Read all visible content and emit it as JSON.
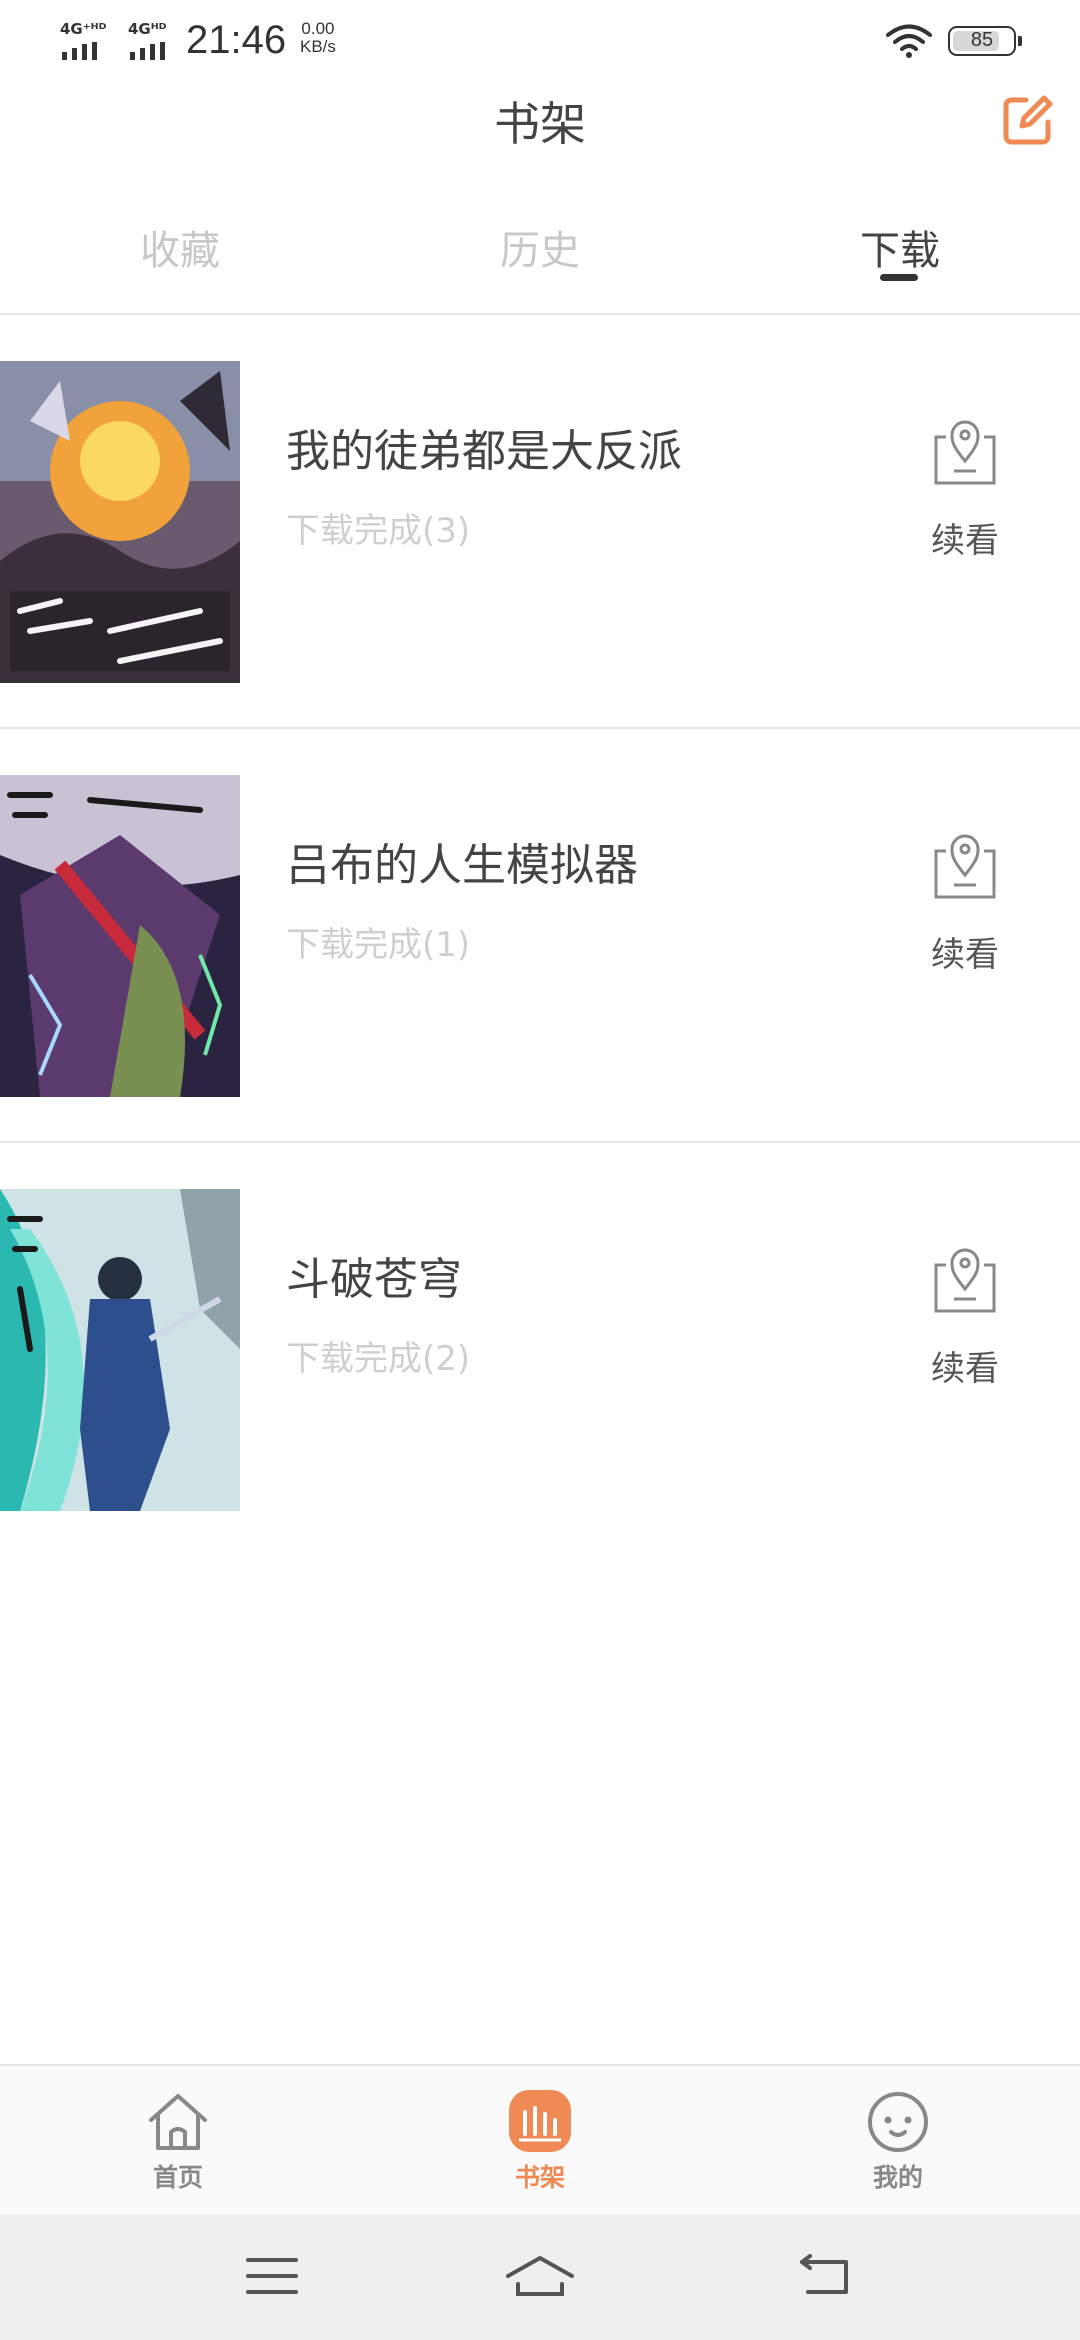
{
  "status_bar": {
    "sim1": "4G⁺ᴴᴰ",
    "sim2": "4Gᴴᴰ",
    "time": "21:46",
    "net_speed_value": "0.00",
    "net_speed_unit": "KB/s",
    "battery": "85"
  },
  "header": {
    "title": "书架",
    "edit_icon": "edit-icon"
  },
  "tabs": [
    {
      "label": "收藏",
      "active": false
    },
    {
      "label": "历史",
      "active": false
    },
    {
      "label": "下载",
      "active": true
    }
  ],
  "books": [
    {
      "title": "我的徒弟都是大反派",
      "status": "下载完成(3)",
      "action": "续看"
    },
    {
      "title": "吕布的人生模拟器",
      "status": "下载完成(1)",
      "action": "续看"
    },
    {
      "title": "斗破苍穹",
      "status": "下载完成(2)",
      "action": "续看"
    }
  ],
  "bottom_nav": [
    {
      "label": "首页",
      "icon": "home-icon",
      "active": false
    },
    {
      "label": "书架",
      "icon": "bookshelf-icon",
      "active": true
    },
    {
      "label": "我的",
      "icon": "profile-face-icon",
      "active": false
    }
  ],
  "colors": {
    "accent": "#f08a54",
    "inactive_tab": "#c8c8c8",
    "status_text": "#cfcfcf"
  }
}
